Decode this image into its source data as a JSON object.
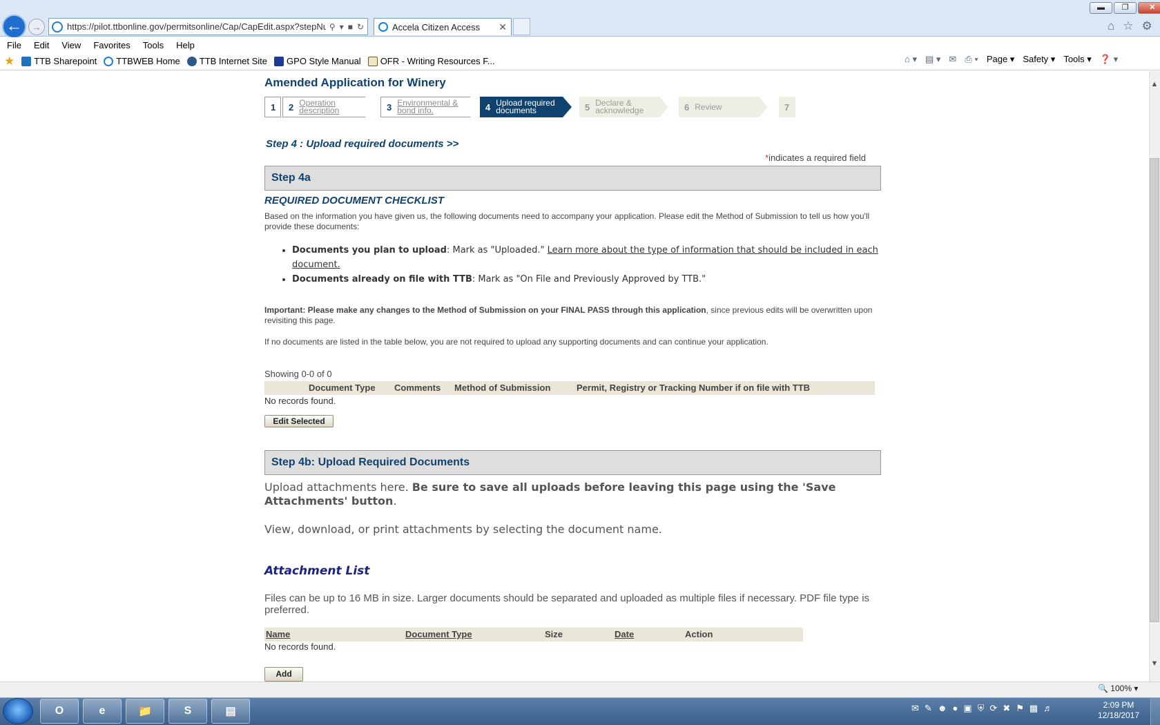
{
  "browser": {
    "url": "https://pilot.ttbonline.gov/permitsonline/Cap/CapEdit.aspx?stepNuml",
    "tab_title": "Accela Citizen Access",
    "menu": [
      "File",
      "Edit",
      "View",
      "Favorites",
      "Tools",
      "Help"
    ],
    "favorites": [
      "TTB Sharepoint",
      "TTBWEB Home",
      "TTB Internet Site",
      "GPO Style Manual",
      "OFR - Writing Resources F..."
    ],
    "commands": [
      "Page",
      "Safety",
      "Tools"
    ],
    "zoom": "100%"
  },
  "page": {
    "title": "Amended Application for Winery",
    "wizard": [
      {
        "num": "1",
        "label": "",
        "state": "done"
      },
      {
        "num": "2",
        "label": "Operation description",
        "state": "done"
      },
      {
        "num": "3",
        "label": "Environmental & bond info.",
        "state": "done"
      },
      {
        "num": "4",
        "label": "Upload required documents",
        "state": "active"
      },
      {
        "num": "5",
        "label": "Declare & acknowledge",
        "state": "future"
      },
      {
        "num": "6",
        "label": "Review",
        "state": "future"
      },
      {
        "num": "7",
        "label": "",
        "state": "future"
      }
    ],
    "step_heading": "Step 4 : Upload required documents >>",
    "required_asterisk": "*",
    "required_note": "indicates a required field",
    "step4a": {
      "title": "Step 4a",
      "checklist_title": "REQUIRED DOCUMENT CHECKLIST",
      "intro": "Based on the information you have given us, the following documents need to accompany your application. Please edit the Method of Submission to tell us how you'll provide these documents:",
      "bullet1_bold": "Documents you plan to upload",
      "bullet1_text": ": Mark as \"Uploaded.\" ",
      "bullet1_link": "Learn more about the type of information that should be included in each document.",
      "bullet2_bold": "Documents already on file with TTB",
      "bullet2_text": ": Mark as \"On File and Previously Approved by TTB.\"",
      "important_bold": "Important: Please make any changes to the Method of Submission on your FINAL PASS through this application",
      "important_text": ", since previous edits will be overwritten upon revisiting this page.",
      "no_docs_note": "If no documents are listed in the table below, you are not required to upload any supporting documents and can continue your application.",
      "showing": "Showing 0-0 of 0",
      "columns": [
        "Document Type",
        "Comments",
        "Method of Submission",
        "Permit, Registry or Tracking Number if on file with TTB"
      ],
      "no_records": "No records found.",
      "edit_button": "Edit Selected"
    },
    "step4b": {
      "title": "Step 4b: Upload Required Documents",
      "upload_intro": "Upload attachments here. ",
      "upload_bold": "Be sure to save all uploads before leaving this page using the 'Save Attachments' button",
      "upload_end": ".",
      "view_note": "View, download, or print attachments by selecting the document name.",
      "attachment_title": "Attachment List",
      "files_note": "Files can be up to 16 MB in size. Larger documents should be separated and uploaded as multiple files if necessary. PDF file type is preferred.",
      "columns": [
        "Name",
        "Document Type",
        "Size",
        "Date",
        "Action"
      ],
      "no_records": "No records found.",
      "add_button": "Add"
    }
  },
  "taskbar": {
    "time": "2:09 PM",
    "date": "12/18/2017"
  }
}
